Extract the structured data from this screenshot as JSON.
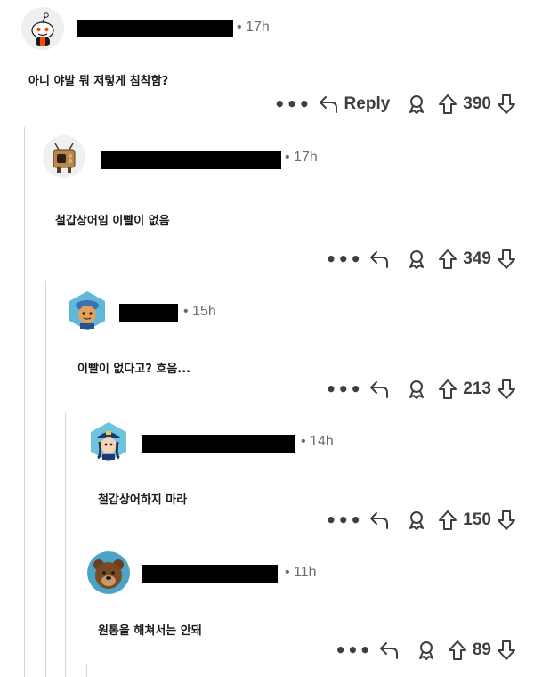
{
  "comments": [
    {
      "author_redacted": true,
      "time": "• 17h",
      "text": "아니 야발 뭐 저렇게 침착함?",
      "reply_label": "Reply",
      "score": "390",
      "more_label": "•••",
      "avatar_icon": "snoo-avatar-icon"
    },
    {
      "author_redacted": true,
      "time": "• 17h",
      "text": "철갑상어임 이빨이 없음",
      "score": "349",
      "more_label": "•••",
      "avatar_icon": "robot-avatar-icon"
    },
    {
      "author_redacted": true,
      "time": "• 15h",
      "text": "이빨이 없다고? 흐음...",
      "score": "213",
      "more_label": "•••",
      "avatar_icon": "capped-avatar-icon"
    },
    {
      "author_redacted": true,
      "time": "• 14h",
      "text": "철갑상어하지 마라",
      "score": "150",
      "more_label": "•••",
      "avatar_icon": "police-avatar-icon"
    },
    {
      "author_redacted": true,
      "time": "• 11h",
      "text": "원통을 해쳐서는 안돼",
      "score": "89",
      "more_label": "•••",
      "avatar_icon": "bear-avatar-icon"
    }
  ],
  "colors": {
    "thread_line": "#d3d6da",
    "icon": "#3c3f42",
    "meta": "#6a6d70"
  }
}
